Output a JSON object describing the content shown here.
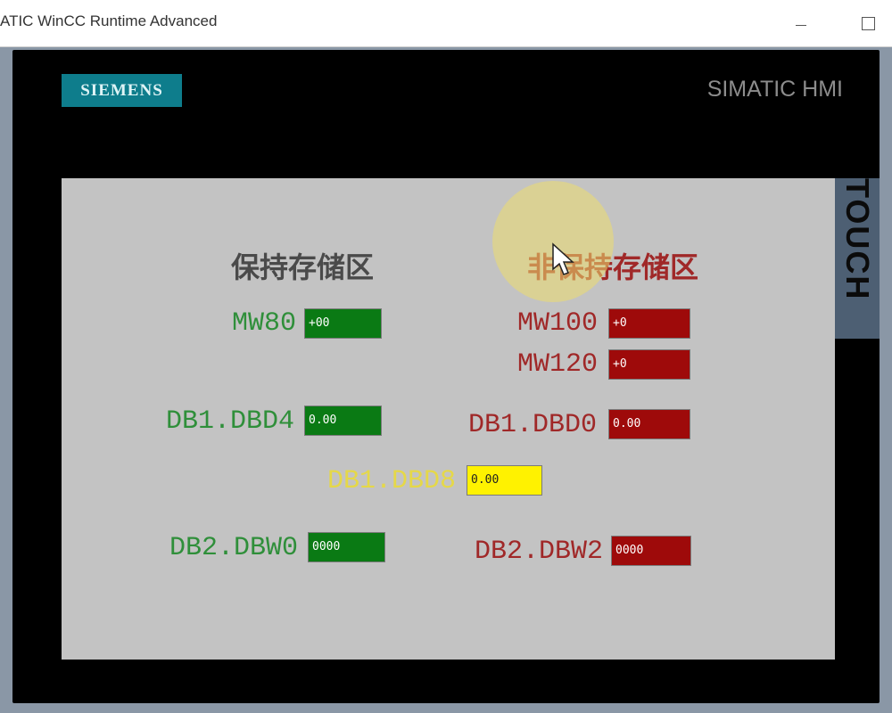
{
  "window": {
    "title": "ATIC WinCC Runtime Advanced",
    "minimize_label": "",
    "maximize_label": ""
  },
  "device": {
    "brand": "SIEMENS",
    "model": "SIMATIC HMI",
    "side_label": "TOUCH"
  },
  "screen": {
    "heading_retentive": "保持存储区",
    "heading_non_retentive": "非保持存储区",
    "retentive": [
      {
        "label": "MW80",
        "value": "+00"
      },
      {
        "label": "DB1.DBD4",
        "value": "0.00"
      },
      {
        "label": "DB2.DBW0",
        "value": "0000"
      }
    ],
    "non_retentive": [
      {
        "label": "MW100",
        "value": "+0"
      },
      {
        "label": "MW120",
        "value": "+0"
      },
      {
        "label": "DB1.DBD0",
        "value": "0.00"
      },
      {
        "label": "DB2.DBW2",
        "value": "0000"
      }
    ],
    "center": {
      "label": "DB1.DBD8",
      "value": "0.00"
    }
  },
  "colors": {
    "retentive": "#2f8f3a",
    "non_retentive": "#a02828",
    "center": "#e5d848",
    "siemens_teal": "#0e7d8c",
    "screen_bg": "#c3c3c3"
  }
}
